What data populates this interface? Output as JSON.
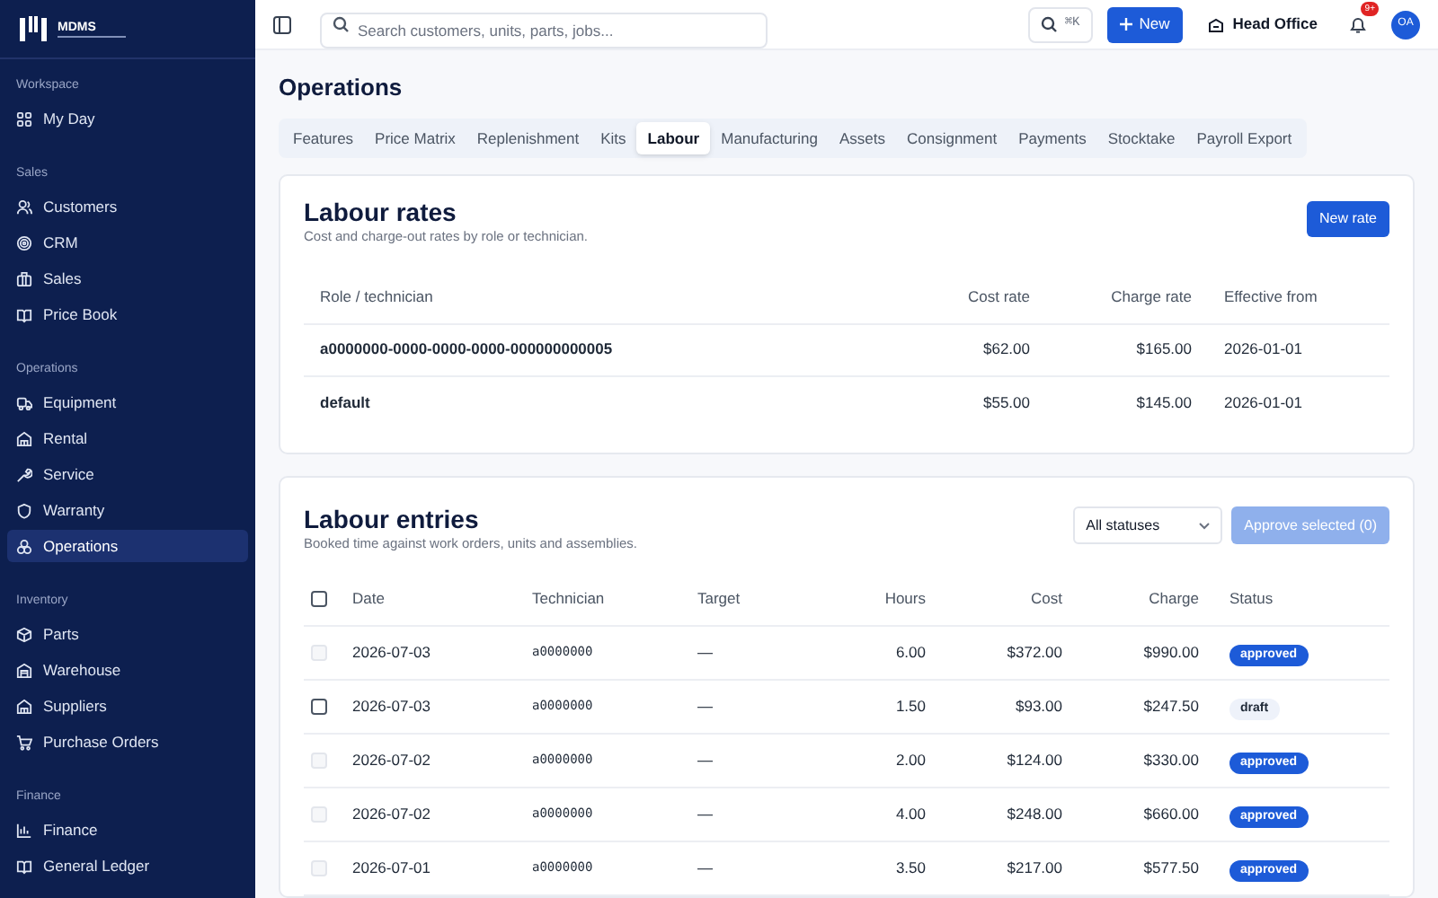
{
  "brand": {
    "name": "MDMS"
  },
  "sidebar": {
    "sections": [
      {
        "label": "Workspace",
        "items": [
          {
            "label": "My Day",
            "selected": false
          }
        ]
      },
      {
        "label": "Sales",
        "items": [
          {
            "label": "Customers",
            "selected": false
          },
          {
            "label": "CRM",
            "selected": false
          },
          {
            "label": "Sales",
            "selected": false
          },
          {
            "label": "Price Book",
            "selected": false
          }
        ]
      },
      {
        "label": "Operations",
        "items": [
          {
            "label": "Equipment",
            "selected": false
          },
          {
            "label": "Rental",
            "selected": false
          },
          {
            "label": "Service",
            "selected": false
          },
          {
            "label": "Warranty",
            "selected": false
          },
          {
            "label": "Operations",
            "selected": true
          }
        ]
      },
      {
        "label": "Inventory",
        "items": [
          {
            "label": "Parts",
            "selected": false
          },
          {
            "label": "Warehouse",
            "selected": false
          },
          {
            "label": "Suppliers",
            "selected": false
          },
          {
            "label": "Purchase Orders",
            "selected": false
          }
        ]
      },
      {
        "label": "Finance",
        "items": [
          {
            "label": "Finance",
            "selected": false
          },
          {
            "label": "General Ledger",
            "selected": false
          }
        ]
      }
    ]
  },
  "topbar": {
    "search": {
      "placeholder": "Search customers, units, parts, jobs..."
    },
    "shortcut": "⌘K",
    "new_button": "New",
    "branch": "Head Office",
    "notifications": "9+",
    "avatar": "OA"
  },
  "page": {
    "title": "Operations"
  },
  "tabs": [
    {
      "label": "Features",
      "selected": false
    },
    {
      "label": "Price Matrix",
      "selected": false
    },
    {
      "label": "Replenishment",
      "selected": false
    },
    {
      "label": "Kits",
      "selected": false
    },
    {
      "label": "Labour",
      "selected": true
    },
    {
      "label": "Manufacturing",
      "selected": false
    },
    {
      "label": "Assets",
      "selected": false
    },
    {
      "label": "Consignment",
      "selected": false
    },
    {
      "label": "Payments",
      "selected": false
    },
    {
      "label": "Stocktake",
      "selected": false
    },
    {
      "label": "Payroll Export",
      "selected": false
    }
  ],
  "rates": {
    "title": "Labour rates",
    "subtitle": "Cost and charge-out rates by role or technician.",
    "button": "New rate",
    "columns": [
      "Role / technician",
      "Cost rate",
      "Charge rate",
      "Effective from"
    ],
    "rows": [
      [
        "a0000000-0000-0000-0000-000000000005",
        "$62.00",
        "$165.00",
        "2026-01-01"
      ],
      [
        "default",
        "$55.00",
        "$145.00",
        "2026-01-01"
      ]
    ]
  },
  "entries": {
    "title": "Labour entries",
    "subtitle": "Booked time against work orders, units and assemblies.",
    "filter": "All statuses",
    "approve_button": {
      "label": "Approve selected (0)",
      "disabled": true
    },
    "select_all": {
      "checked": false
    },
    "columns": [
      "Date",
      "Technician",
      "Target",
      "Hours",
      "Cost",
      "Charge",
      "Status"
    ],
    "rows": [
      {
        "checked": false,
        "disabled": true,
        "cells": [
          "2026-07-03",
          "a0000000",
          "—",
          "6.00",
          "$372.00",
          "$990.00"
        ],
        "status": "approved",
        "color": "#1d5bd8"
      },
      {
        "checked": false,
        "disabled": false,
        "cells": [
          "2026-07-03",
          "a0000000",
          "—",
          "1.50",
          "$93.00",
          "$247.50"
        ],
        "status": "draft",
        "color": "#eef2fa"
      },
      {
        "checked": false,
        "disabled": true,
        "cells": [
          "2026-07-02",
          "a0000000",
          "—",
          "2.00",
          "$124.00",
          "$330.00"
        ],
        "status": "approved",
        "color": "#1d5bd8"
      },
      {
        "checked": false,
        "disabled": true,
        "cells": [
          "2026-07-02",
          "a0000000",
          "—",
          "4.00",
          "$248.00",
          "$660.00"
        ],
        "status": "approved",
        "color": "#1d5bd8"
      },
      {
        "checked": false,
        "disabled": true,
        "cells": [
          "2026-07-01",
          "a0000000",
          "—",
          "3.50",
          "$217.00",
          "$577.50"
        ],
        "status": "approved",
        "color": "#1d5bd8"
      }
    ]
  }
}
